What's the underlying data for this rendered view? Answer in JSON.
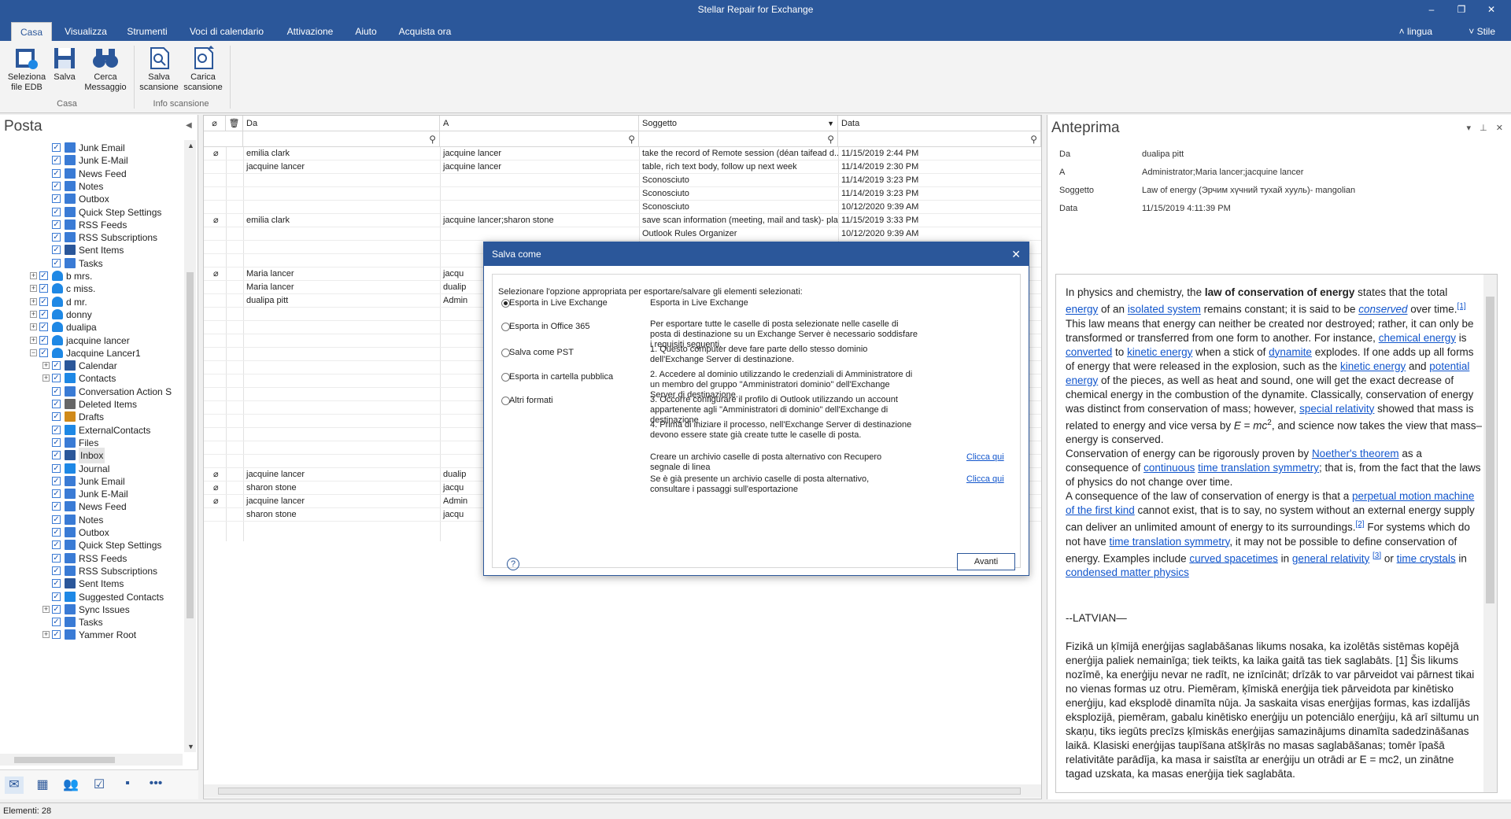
{
  "window": {
    "title": "Stellar Repair for Exchange"
  },
  "tabs": [
    "Casa",
    "Visualizza",
    "Strumenti",
    "Voci di calendario",
    "Attivazione",
    "Aiuto",
    "Acquista ora"
  ],
  "tab_right": {
    "language": "lingua",
    "style": "Stile"
  },
  "ribbon": {
    "buttons": [
      {
        "label1": "Seleziona",
        "label2": "file EDB"
      },
      {
        "label1": "Salva",
        "label2": ""
      },
      {
        "label1": "Cerca",
        "label2": "Messaggio"
      },
      {
        "label1": "Salva",
        "label2": "scansione"
      },
      {
        "label1": "Carica",
        "label2": "scansione"
      }
    ],
    "groups": [
      "Casa",
      "Info scansione"
    ]
  },
  "left": {
    "title": "Posta",
    "tree": [
      {
        "label": "Junk Email",
        "level": 2,
        "icon": "folder-icon"
      },
      {
        "label": "Junk E-Mail",
        "level": 2,
        "icon": "folder-icon"
      },
      {
        "label": "News Feed",
        "level": 2,
        "icon": "folder-icon"
      },
      {
        "label": "Notes",
        "level": 2,
        "icon": "folder-icon"
      },
      {
        "label": "Outbox",
        "level": 2,
        "icon": "folder-icon"
      },
      {
        "label": "Quick Step Settings",
        "level": 2,
        "icon": "folder-icon"
      },
      {
        "label": "RSS Feeds",
        "level": 2,
        "icon": "folder-icon"
      },
      {
        "label": "RSS Subscriptions",
        "level": 2,
        "icon": "folder-icon"
      },
      {
        "label": "Sent Items",
        "level": 2,
        "icon": "sent-icon"
      },
      {
        "label": "Tasks",
        "level": 2,
        "icon": "folder-icon"
      },
      {
        "label": "b mrs.",
        "level": 1,
        "icon": "user-icon",
        "expander": "+"
      },
      {
        "label": "c miss.",
        "level": 1,
        "icon": "user-icon",
        "expander": "+"
      },
      {
        "label": "d mr.",
        "level": 1,
        "icon": "user-icon",
        "expander": "+"
      },
      {
        "label": "donny",
        "level": 1,
        "icon": "user-icon",
        "expander": "+"
      },
      {
        "label": "dualipa",
        "level": 1,
        "icon": "user-icon",
        "expander": "+"
      },
      {
        "label": "jacquine lancer",
        "level": 1,
        "icon": "user-icon",
        "expander": "+"
      },
      {
        "label": "Jacquine Lancer1",
        "level": 1,
        "icon": "user-icon",
        "expander": "−"
      },
      {
        "label": "Calendar",
        "level": 2,
        "icon": "calendar-icon",
        "expander": "+"
      },
      {
        "label": "Contacts",
        "level": 2,
        "icon": "contacts-icon",
        "expander": "+"
      },
      {
        "label": "Conversation Action S",
        "level": 2,
        "icon": "folder-icon"
      },
      {
        "label": "Deleted Items",
        "level": 2,
        "icon": "trash-icon"
      },
      {
        "label": "Drafts",
        "level": 2,
        "icon": "drafts-icon"
      },
      {
        "label": "ExternalContacts",
        "level": 2,
        "icon": "contacts-icon"
      },
      {
        "label": "Files",
        "level": 2,
        "icon": "folder-icon"
      },
      {
        "label": "Inbox",
        "level": 2,
        "icon": "inbox-icon",
        "selected": true
      },
      {
        "label": "Journal",
        "level": 2,
        "icon": "journal-icon"
      },
      {
        "label": "Junk Email",
        "level": 2,
        "icon": "folder-icon"
      },
      {
        "label": "Junk E-Mail",
        "level": 2,
        "icon": "folder-icon"
      },
      {
        "label": "News Feed",
        "level": 2,
        "icon": "folder-icon"
      },
      {
        "label": "Notes",
        "level": 2,
        "icon": "folder-icon"
      },
      {
        "label": "Outbox",
        "level": 2,
        "icon": "folder-icon"
      },
      {
        "label": "Quick Step Settings",
        "level": 2,
        "icon": "folder-icon"
      },
      {
        "label": "RSS Feeds",
        "level": 2,
        "icon": "folder-icon"
      },
      {
        "label": "RSS Subscriptions",
        "level": 2,
        "icon": "folder-icon"
      },
      {
        "label": "Sent Items",
        "level": 2,
        "icon": "sent-icon"
      },
      {
        "label": "Suggested Contacts",
        "level": 2,
        "icon": "contacts-icon"
      },
      {
        "label": "Sync Issues",
        "level": 2,
        "icon": "folder-icon",
        "expander": "+"
      },
      {
        "label": "Tasks",
        "level": 2,
        "icon": "folder-icon"
      },
      {
        "label": "Yammer Root",
        "level": 2,
        "icon": "folder-icon",
        "expander": "+"
      }
    ],
    "nav_icons": [
      "mail-icon",
      "calendar-icon",
      "people-icon",
      "tasks-icon",
      "notes-icon",
      "more-icon"
    ]
  },
  "list": {
    "headers": {
      "from": "Da",
      "to": "A",
      "subject": "Soggetto",
      "date": "Data"
    },
    "rows": [
      {
        "att": true,
        "from": "emilia clark",
        "to": "jacquine lancer",
        "subject": "take the record of Remote session (déan taifead d...",
        "date": "11/15/2019 2:44 PM"
      },
      {
        "att": false,
        "from": "jacquine lancer",
        "to": "jacquine lancer",
        "subject": "table, rich text body, follow up next week",
        "date": "11/14/2019 2:30 PM"
      },
      {
        "att": false,
        "from": "",
        "to": "",
        "subject": "Sconosciuto",
        "date": "11/14/2019 3:23 PM"
      },
      {
        "att": false,
        "from": "",
        "to": "",
        "subject": "Sconosciuto",
        "date": "11/14/2019 3:23 PM"
      },
      {
        "att": false,
        "from": "",
        "to": "",
        "subject": "Sconosciuto",
        "date": "10/12/2020 9:39 AM"
      },
      {
        "att": true,
        "from": "emilia clark",
        "to": "jacquine lancer;sharon stone",
        "subject": "save scan information (meeting, mail and task)- pla...",
        "date": "11/15/2019 3:33 PM"
      },
      {
        "att": false,
        "from": "",
        "to": "",
        "subject": "Outlook Rules Organizer",
        "date": "10/12/2020 9:39 AM"
      },
      {
        "att": false,
        "from": "",
        "to": "",
        "subject": "",
        "date": ""
      },
      {
        "att": false,
        "from": "",
        "to": "",
        "subject": "",
        "date": ""
      },
      {
        "att": true,
        "from": "Maria lancer",
        "to": "jacqu",
        "subject": "",
        "date": ""
      },
      {
        "att": false,
        "from": "Maria lancer",
        "to": "dualip",
        "subject": "",
        "date": ""
      },
      {
        "att": false,
        "from": "dualipa pitt",
        "to": "Admin",
        "subject": "",
        "date": ""
      },
      {
        "att": false,
        "from": "",
        "to": "",
        "subject": "",
        "date": ""
      },
      {
        "att": false,
        "from": "",
        "to": "",
        "subject": "",
        "date": ""
      },
      {
        "att": false,
        "from": "",
        "to": "",
        "subject": "",
        "date": ""
      },
      {
        "att": false,
        "from": "",
        "to": "",
        "subject": "",
        "date": ""
      },
      {
        "att": false,
        "from": "",
        "to": "",
        "subject": "",
        "date": ""
      },
      {
        "att": false,
        "from": "",
        "to": "",
        "subject": "",
        "date": ""
      },
      {
        "att": false,
        "from": "",
        "to": "",
        "subject": "",
        "date": ""
      },
      {
        "att": false,
        "from": "",
        "to": "",
        "subject": "",
        "date": ""
      },
      {
        "att": false,
        "from": "",
        "to": "",
        "subject": "",
        "date": ""
      },
      {
        "att": false,
        "from": "",
        "to": "",
        "subject": "",
        "date": ""
      },
      {
        "att": false,
        "from": "",
        "to": "",
        "subject": "",
        "date": ""
      },
      {
        "att": false,
        "from": "",
        "to": "",
        "subject": "",
        "date": ""
      },
      {
        "att": true,
        "from": "jacquine lancer",
        "to": "dualip",
        "subject": "",
        "date": ""
      },
      {
        "att": true,
        "from": "sharon stone",
        "to": "jacqu",
        "subject": "",
        "date": ""
      },
      {
        "att": true,
        "from": "jacquine lancer",
        "to": "Admin",
        "subject": "",
        "date": ""
      },
      {
        "att": false,
        "from": "sharon stone",
        "to": "jacqu",
        "subject": "",
        "date": ""
      }
    ]
  },
  "preview": {
    "title": "Anteprima",
    "fields": [
      {
        "label": "Da",
        "value": "dualipa pitt"
      },
      {
        "label": "A",
        "value": "Administrator;Maria lancer;jacquine lancer"
      },
      {
        "label": "Soggetto",
        "value": "Law of energy (Эрчим хүчний тухай хууль)- mangolian"
      },
      {
        "label": "Data",
        "value": "11/15/2019 4:11:39 PM"
      }
    ],
    "body": {
      "p1": [
        {
          "t": "In physics and chemistry, the "
        },
        {
          "t": "law of conservation of energy",
          "b": true
        },
        {
          "t": " states that the total "
        },
        {
          "t": "energy",
          "a": true
        },
        {
          "t": " of an "
        },
        {
          "t": "isolated system",
          "a": true
        },
        {
          "t": " remains constant; it is said to be "
        },
        {
          "t": "conserved",
          "a": true,
          "i": true
        },
        {
          "t": " over time."
        },
        {
          "t": "[1]",
          "a": true,
          "sup": true
        },
        {
          "t": " This law means that energy can neither be created nor destroyed; rather, it can only be transformed or transferred from one form to another. For instance, "
        },
        {
          "t": "chemical energy",
          "a": true
        },
        {
          "t": " is "
        },
        {
          "t": "converted",
          "a": true
        },
        {
          "t": " to "
        },
        {
          "t": "kinetic energy",
          "a": true
        },
        {
          "t": " when a stick of "
        },
        {
          "t": "dynamite",
          "a": true
        },
        {
          "t": " explodes. If one adds up all forms of energy that were released in the explosion, such as the "
        },
        {
          "t": "kinetic energy",
          "a": true
        },
        {
          "t": " and "
        },
        {
          "t": "potential energy",
          "a": true
        },
        {
          "t": " of the pieces, as well as heat and sound, one will get the exact decrease of chemical energy in the combustion of the dynamite. Classically, conservation of energy was distinct from conservation of mass; however, "
        },
        {
          "t": "special relativity",
          "a": true
        },
        {
          "t": " showed that mass is related to energy and vice versa by "
        },
        {
          "t": "E",
          "i": true
        },
        {
          "t": " = "
        },
        {
          "t": "mc",
          "i": true
        },
        {
          "t": "2",
          "sup": true
        },
        {
          "t": ", and science now takes the view that mass–energy is conserved."
        }
      ],
      "p2": [
        {
          "t": "Conservation of energy can be rigorously proven by "
        },
        {
          "t": "Noether's theorem",
          "a": true
        },
        {
          "t": " as a consequence of "
        },
        {
          "t": "continuous",
          "a": true
        },
        {
          "t": " "
        },
        {
          "t": "time translation symmetry",
          "a": true
        },
        {
          "t": "; that is, from the fact that the laws of physics do not change over time."
        }
      ],
      "p3": [
        {
          "t": "A consequence of the law of conservation of energy is that a "
        },
        {
          "t": "perpetual motion machine of the first kind",
          "a": true
        },
        {
          "t": " cannot exist, that is to say, no system without an external energy supply can deliver an unlimited amount of energy to its surroundings."
        },
        {
          "t": "[2]",
          "a": true,
          "sup": true
        },
        {
          "t": " For systems which do not have "
        },
        {
          "t": "time translation symmetry",
          "a": true
        },
        {
          "t": ", it may not be possible to define conservation of energy. Examples include "
        },
        {
          "t": "curved spacetimes",
          "a": true
        },
        {
          "t": " in "
        },
        {
          "t": "general relativity",
          "a": true
        },
        {
          "t": " "
        },
        {
          "t": "[3]",
          "a": true,
          "sup": true
        },
        {
          "t": " or "
        },
        {
          "t": "time crystals",
          "a": true
        },
        {
          "t": " in "
        },
        {
          "t": "condensed matter physics",
          "a": true
        }
      ],
      "heading2": "--LATVIAN—",
      "p4": "Fizikā un ķīmijā enerģijas saglabāšanas likums nosaka, ka izolētās sistēmas kopējā enerģija paliek nemainīga; tiek teikts, ka laika gaitā tas tiek saglabāts. [1] Šis likums nozīmē, ka enerģiju nevar ne radīt, ne iznīcināt; drīzāk to var pārveidot vai pārnest tikai no vienas formas uz otru. Piemēram, ķīmiskā enerģija tiek pārveidota par kinētisko enerģiju, kad eksplodē dinamīta nūja. Ja saskaita visas enerģijas formas, kas izdalījās eksplozijā, piemēram, gabalu kinētisko enerģiju un potenciālo enerģiju, kā arī siltumu un skaņu, tiks iegūts precīzs ķīmiskās enerģijas samazinājums dinamīta sadedzināšanas laikā. Klasiski enerģijas taupīšana atšķīrās no masas saglabāšanas; tomēr īpašā relativitāte parādīja, ka masa ir saistīta ar enerģiju un otrādi ar E = mc2, un zinātne tagad uzskata, ka masas enerģija tiek saglabāta."
    }
  },
  "dialog": {
    "title": "Salva come",
    "instruction": "Selezionare l'opzione appropriata per esportare/salvare gli elementi selezionati:",
    "options": [
      {
        "label": "Esporta in Live Exchange",
        "selected": true
      },
      {
        "label": "Esporta in Office 365",
        "selected": false
      },
      {
        "label": "Salva come PST",
        "selected": false
      },
      {
        "label": "Esporta in cartella pubblica",
        "selected": false
      },
      {
        "label": "Altri formati",
        "selected": false
      }
    ],
    "detail_title": "Esporta in Live Exchange",
    "detail_paragraphs": [
      "Per esportare tutte le caselle di posta selezionate nelle caselle di posta di destinazione su un Exchange Server è necessario soddisfare i requisiti seguenti.",
      "1. Questo computer deve fare parte dello stesso dominio dell'Exchange Server di destinazione.",
      "2. Accedere al dominio utilizzando le credenziali di Amministratore di un membro del gruppo \"Amministratori dominio\" dell'Exchange Server di destinazione.",
      "3. Occorre configurare il profilo di Outlook utilizzando un account appartenente agli \"Amministratori di dominio\" dell'Exchange di destinazione",
      "4. Prima di iniziare il processo, nell'Exchange Server di destinazione devono essere state già create tutte le caselle di posta."
    ],
    "link_rows": [
      {
        "text": "Creare un archivio caselle di posta alternativo con Recupero segnale di linea",
        "link": "Clicca qui"
      },
      {
        "text": "Se è già presente un archivio caselle di posta alternativo, consultare i passaggi sull'esportazione",
        "link": "Clicca qui"
      }
    ],
    "next_button": "Avanti"
  },
  "status": {
    "text": "Elementi: 28"
  }
}
